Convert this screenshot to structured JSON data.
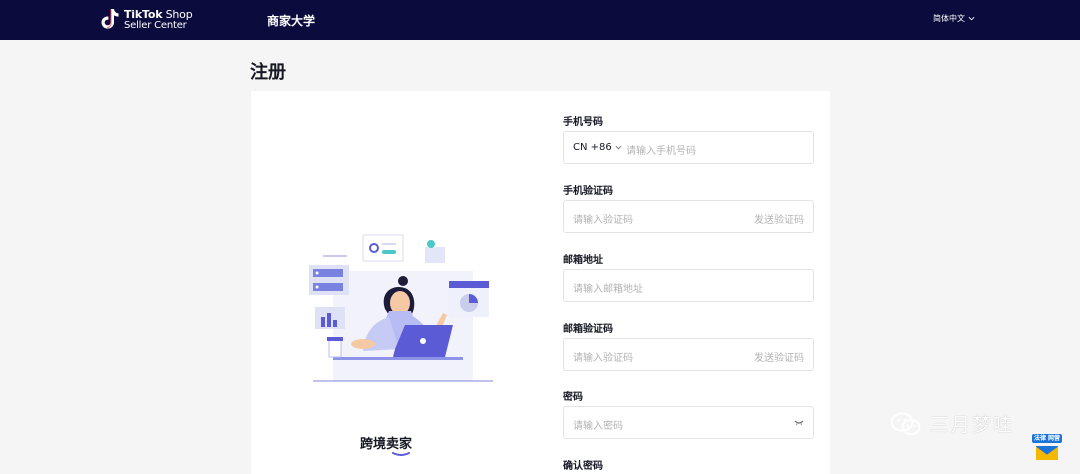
{
  "header": {
    "logo_brand": "TikTok",
    "logo_product": " Shop",
    "logo_sub": "Seller Center",
    "nav_link": "商家大学",
    "language": "简体中文"
  },
  "page": {
    "title": "注册"
  },
  "illustration": {
    "caption": "跨境卖家"
  },
  "form": {
    "phone": {
      "label": "手机号码",
      "country_code": "CN +86",
      "placeholder": "请输入手机号码"
    },
    "phone_code": {
      "label": "手机验证码",
      "placeholder": "请输入验证码",
      "send_label": "发送验证码"
    },
    "email": {
      "label": "邮箱地址",
      "placeholder": "请输入邮箱地址"
    },
    "email_code": {
      "label": "邮箱验证码",
      "placeholder": "请输入验证码",
      "send_label": "发送验证码"
    },
    "password": {
      "label": "密码",
      "placeholder": "请输入密码"
    },
    "confirm_password": {
      "label": "确认密码"
    }
  },
  "watermark": {
    "text": "三月梦哇",
    "badge": "法律 网营"
  },
  "colors": {
    "topbar": "#0b0c3d",
    "accent": "#5b5bd6",
    "placeholder": "#b3b3b5",
    "border": "#e3e3e4"
  }
}
